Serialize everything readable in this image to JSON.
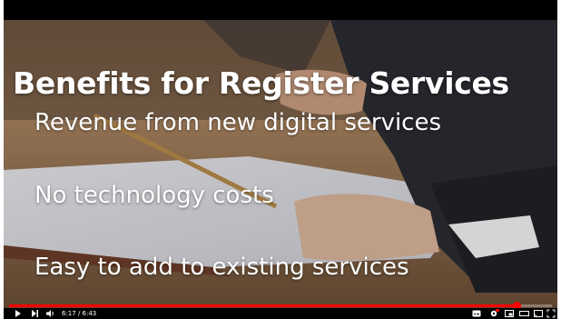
{
  "slide": {
    "title": "Benefits for Register Services",
    "bullets": [
      "Revenue from new digital services",
      "No technology costs",
      "Easy to add to existing services"
    ]
  },
  "player": {
    "time_display": "6:17 / 6:43",
    "progress_fraction": 0.935,
    "accent_color": "#ff0000",
    "icons": [
      "play-icon",
      "next-icon",
      "volume-icon",
      "subtitles-icon",
      "settings-icon",
      "miniplayer-icon",
      "theater-icon",
      "cast-icon",
      "fullscreen-icon"
    ]
  }
}
